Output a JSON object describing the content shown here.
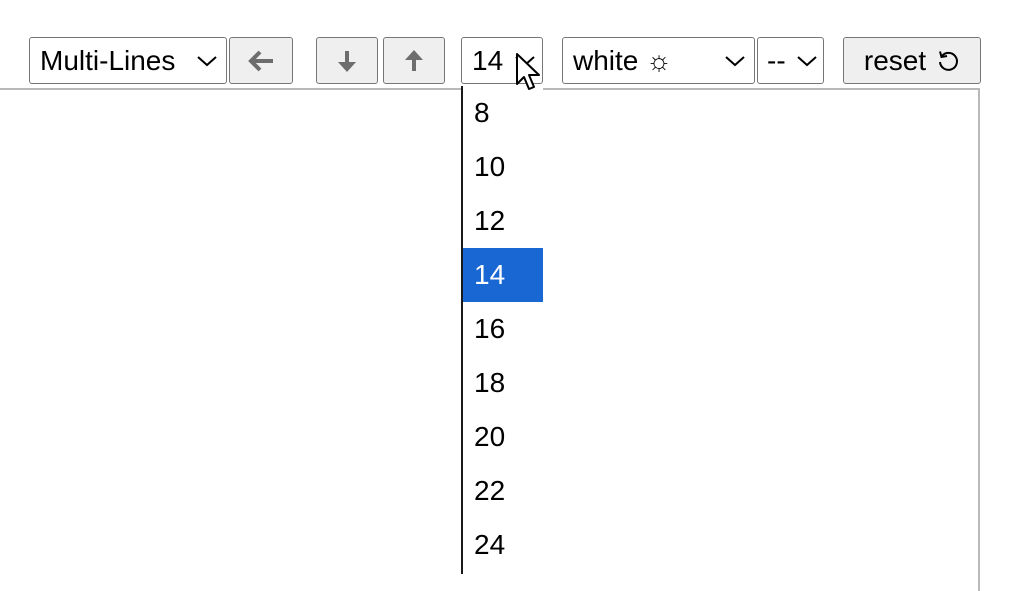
{
  "toolbar": {
    "mode_select": {
      "value": "Multi-Lines"
    },
    "back_button": {
      "icon": "arrow-left-icon"
    },
    "down_button": {
      "icon": "arrow-down-icon"
    },
    "up_button": {
      "icon": "arrow-up-icon"
    },
    "font_size_select": {
      "value": "14",
      "options": [
        "8",
        "10",
        "12",
        "14",
        "16",
        "18",
        "20",
        "22",
        "24"
      ]
    },
    "theme_select": {
      "value": "white ☼"
    },
    "extra_select": {
      "value": "--"
    },
    "reset_button": {
      "label": "reset",
      "icon": "rotate-ccw-icon"
    }
  },
  "colors": {
    "selected_option_bg": "#1967d2",
    "button_bg": "#efefef",
    "border": "#767676"
  }
}
